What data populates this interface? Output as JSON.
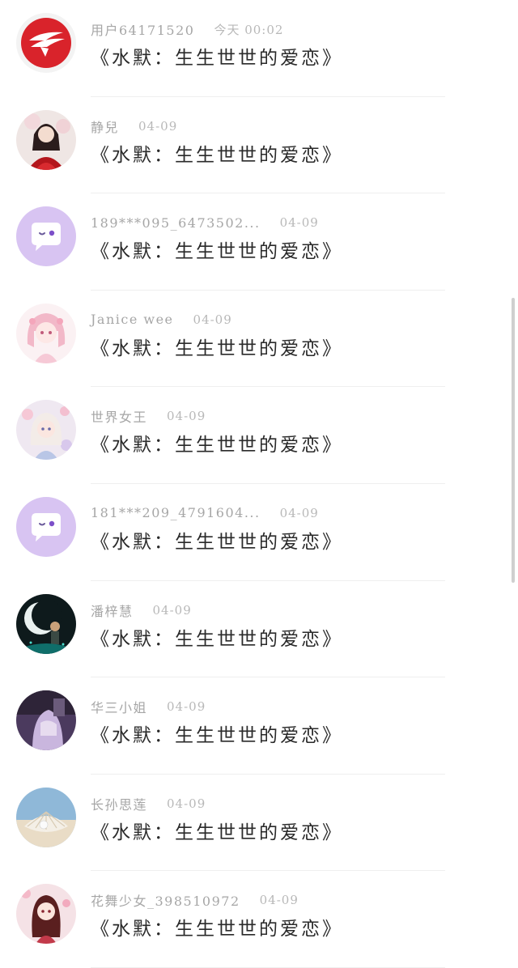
{
  "comments": [
    {
      "user": "用户64171520",
      "time": "今天 00:02",
      "text": "《水默：生生世世的爱恋》",
      "avatar": "brand-logo"
    },
    {
      "user": "静兒",
      "time": "04-09",
      "text": "《水默：生生世世的爱恋》",
      "avatar": "girl-red-dress"
    },
    {
      "user": "189***095_6473502...",
      "time": "04-09",
      "text": "《水默：生生世世的爱恋》",
      "avatar": "default-chat"
    },
    {
      "user": "Janice wee",
      "time": "04-09",
      "text": "《水默：生生世世的爱恋》",
      "avatar": "anime-girl-pink"
    },
    {
      "user": "世界女王",
      "time": "04-09",
      "text": "《水默：生生世世的爱恋》",
      "avatar": "anime-girl-flowers"
    },
    {
      "user": "181***209_4791604...",
      "time": "04-09",
      "text": "《水默：生生世世的爱恋》",
      "avatar": "default-chat"
    },
    {
      "user": "潘梓慧",
      "time": "04-09",
      "text": "《水默：生生世世的爱恋》",
      "avatar": "moon-night"
    },
    {
      "user": "华三小姐",
      "time": "04-09",
      "text": "《水默：生生世世的爱恋》",
      "avatar": "purple-photo"
    },
    {
      "user": "长孙思莲",
      "time": "04-09",
      "text": "《水默：生生世世的爱恋》",
      "avatar": "seashell-pearl"
    },
    {
      "user": "花舞少女_398510972",
      "time": "04-09",
      "text": "《水默：生生世世的爱恋》",
      "avatar": "anime-girl-blossom"
    }
  ],
  "colors": {
    "username": "#a6a6a6",
    "time": "#b8b8b8",
    "text": "#2a2a2a",
    "default_avatar_bg": "#d8c4f2",
    "brand_red": "#d9232b"
  }
}
